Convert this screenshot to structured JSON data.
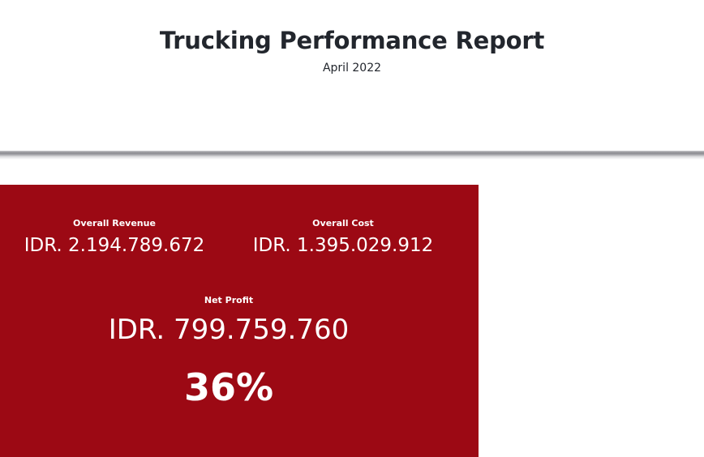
{
  "report": {
    "title": "Trucking Performance Report",
    "period": "April 2022"
  },
  "summary_card": {
    "background_color": "#9c0914",
    "overall_revenue": {
      "label": "Overall Revenue",
      "value": "IDR. 2.194.789.672"
    },
    "overall_cost": {
      "label": "Overall Cost",
      "value": "IDR. 1.395.029.912"
    },
    "net_profit": {
      "label": "Net Profit",
      "value": "IDR. 799.759.760",
      "margin": "36%"
    }
  }
}
